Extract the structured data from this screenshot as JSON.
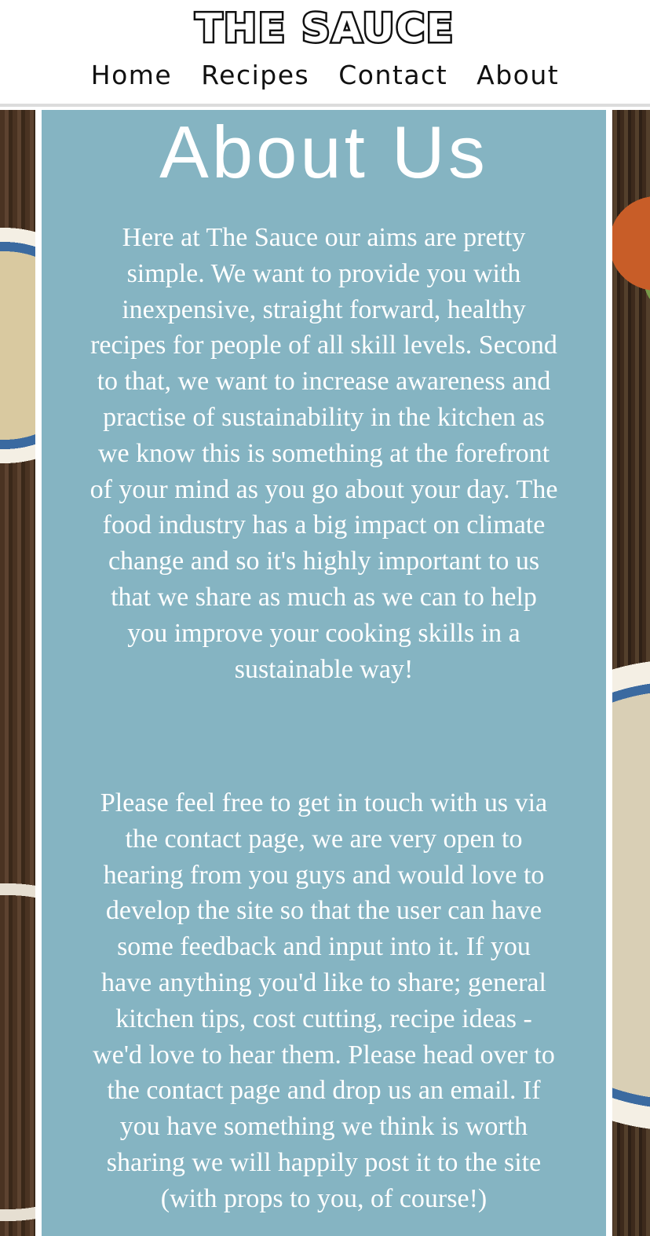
{
  "header": {
    "logo": "THE SAUCE",
    "nav": [
      "Home",
      "Recipes",
      "Contact",
      "About"
    ]
  },
  "main": {
    "title": "About Us",
    "paragraphs": [
      "Here at The Sauce our aims are pretty simple. We want to provide you with inexpensive, straight forward, healthy recipes for people of all skill levels. Second to that, we want to increase awareness and practise of sustainability in the kitchen as we know this is something at the forefront of your mind as you go about your day. The food industry has a big impact on climate change and so it's highly important to us that we share as much as we can to help you improve your cooking skills in a sustainable way!",
      "Please feel free to get in touch with us via the contact page, we are very open to hearing from you guys and would love to develop the site so that the user can have some feedback and input into it. If you have anything you'd like to share; general kitchen tips, cost cutting, recipe ideas - we'd love to hear them. Please head over to the contact page and drop us an email. If you have something we think is worth sharing we will happily post it to the site (with props to you, of course!)"
    ]
  },
  "colors": {
    "panel": "#85b4c2",
    "text_on_panel": "#ffffff",
    "header_bg": "#ffffff",
    "nav_text": "#111111"
  }
}
